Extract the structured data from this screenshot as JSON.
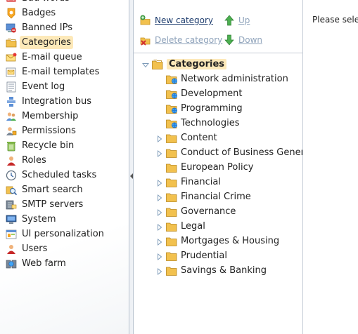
{
  "left_nav": {
    "items": [
      {
        "label": "Bad words",
        "icon": "bad-words-icon"
      },
      {
        "label": "Badges",
        "icon": "badges-icon"
      },
      {
        "label": "Banned IPs",
        "icon": "banned-ips-icon"
      },
      {
        "label": "Categories",
        "icon": "categories-icon",
        "selected": true
      },
      {
        "label": "E-mail queue",
        "icon": "email-queue-icon"
      },
      {
        "label": "E-mail templates",
        "icon": "email-templates-icon"
      },
      {
        "label": "Event log",
        "icon": "event-log-icon"
      },
      {
        "label": "Integration bus",
        "icon": "integration-bus-icon"
      },
      {
        "label": "Membership",
        "icon": "membership-icon"
      },
      {
        "label": "Permissions",
        "icon": "permissions-icon"
      },
      {
        "label": "Recycle bin",
        "icon": "recycle-bin-icon"
      },
      {
        "label": "Roles",
        "icon": "roles-icon"
      },
      {
        "label": "Scheduled tasks",
        "icon": "scheduled-tasks-icon"
      },
      {
        "label": "Smart search",
        "icon": "smart-search-icon"
      },
      {
        "label": "SMTP servers",
        "icon": "smtp-servers-icon"
      },
      {
        "label": "System",
        "icon": "system-icon"
      },
      {
        "label": "UI personalization",
        "icon": "ui-personalization-icon"
      },
      {
        "label": "Users",
        "icon": "users-icon"
      },
      {
        "label": "Web farm",
        "icon": "web-farm-icon"
      }
    ]
  },
  "toolbar": {
    "new_category": "New category",
    "up": "Up",
    "delete_category": "Delete category",
    "down": "Down"
  },
  "tree": {
    "root": "Categories",
    "nodes": [
      {
        "label": "Network administration",
        "kind": "global"
      },
      {
        "label": "Development",
        "kind": "global"
      },
      {
        "label": "Programming",
        "kind": "global"
      },
      {
        "label": "Technologies",
        "kind": "global"
      },
      {
        "label": "Content",
        "kind": "expandable"
      },
      {
        "label": "Conduct of Business Gener",
        "kind": "expandable"
      },
      {
        "label": "European Policy",
        "kind": "leaf"
      },
      {
        "label": "Financial",
        "kind": "expandable"
      },
      {
        "label": "Financial Crime",
        "kind": "expandable"
      },
      {
        "label": "Governance",
        "kind": "expandable"
      },
      {
        "label": "Legal",
        "kind": "expandable"
      },
      {
        "label": "Mortgages & Housing",
        "kind": "expandable"
      },
      {
        "label": "Prudential",
        "kind": "expandable"
      },
      {
        "label": "Savings & Banking",
        "kind": "expandable"
      }
    ]
  },
  "content": {
    "message": "Please selec"
  },
  "colors": {
    "selection": "#fde9b9",
    "link": "#1e3d6e",
    "link_disabled": "#8fa3bb",
    "folder": "#f2c14e"
  }
}
